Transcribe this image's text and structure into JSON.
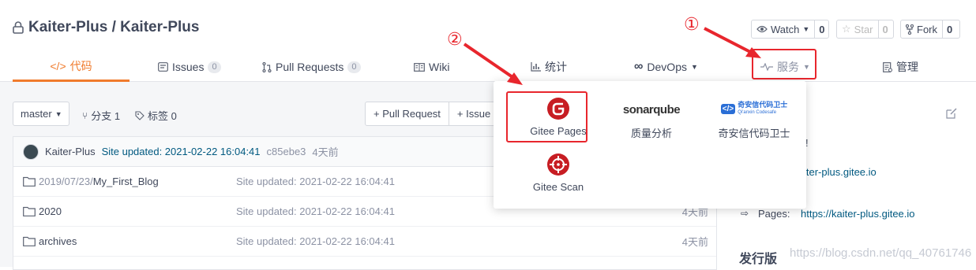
{
  "repo": {
    "title": "Kaiter-Plus / Kaiter-Plus",
    "watch": {
      "label": "Watch",
      "count": "0"
    },
    "star": {
      "label": "Star",
      "count": "0"
    },
    "fork": {
      "label": "Fork",
      "count": "0"
    }
  },
  "tabs": [
    {
      "label": "代码",
      "icon": "code-icon"
    },
    {
      "label": "Issues",
      "badge": "0",
      "icon": "issue-icon"
    },
    {
      "label": "Pull Requests",
      "badge": "0",
      "icon": "pull-request-icon"
    },
    {
      "label": "Wiki",
      "icon": "book-icon"
    },
    {
      "label": "统计",
      "icon": "chart-icon"
    },
    {
      "label": "DevOps",
      "icon": "infinity-icon"
    },
    {
      "label": "服务",
      "icon": "pulse-icon"
    },
    {
      "label": "管理",
      "icon": "settings-doc-icon"
    }
  ],
  "toolbar": {
    "branch": "master",
    "branches": "分支 1",
    "tags": "标签 0",
    "pull_request": "+ Pull Request",
    "issue": "+ Issue"
  },
  "commit": {
    "author": "Kaiter-Plus",
    "message": "Site updated: 2021-02-22 16:04:41",
    "hash": "c85ebe3",
    "time": "4天前"
  },
  "files": [
    {
      "name_prefix": "2019/07/23/",
      "name": "My_First_Blog",
      "message": "Site updated: 2021-02-22 16:04:41",
      "time": ""
    },
    {
      "name_prefix": "",
      "name": "2020",
      "message": "Site updated: 2021-02-22 16:04:41",
      "time": "4天前"
    },
    {
      "name_prefix": "",
      "name": "archives",
      "message": "Site updated: 2021-02-22 16:04:41",
      "time": "4天前"
    }
  ],
  "sidebar": {
    "partial_exclaim": "!",
    "partial_link": "iter-plus.gitee.io",
    "pages_label": "Pages:",
    "pages_link": "https://kaiter-plus.gitee.io",
    "release_title": "发行版",
    "watermark": "https://blog.csdn.net/qq_40761746"
  },
  "dropdown": {
    "gitee_pages": "Gitee Pages",
    "sonarqube_logo": "sonarqube",
    "sonarqube_label": "质量分析",
    "qianxin_logo_cn": "奇安信代码卫士",
    "qianxin_logo_en": "Qi'anxin Codesafe",
    "qianxin_label": "奇安信代码卫士",
    "gitee_scan": "Gitee Scan"
  },
  "annotations": {
    "one": "①",
    "two": "②"
  },
  "colors": {
    "accent": "#f07b2d",
    "annotation": "#e8262d",
    "link": "#005980"
  }
}
